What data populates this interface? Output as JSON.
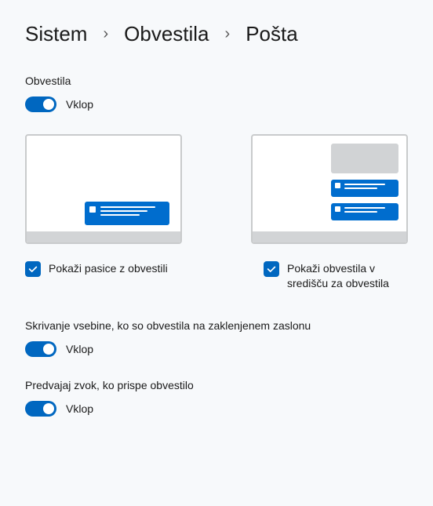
{
  "breadcrumb": {
    "item0": "Sistem",
    "item1": "Obvestila",
    "item2": "Pošta"
  },
  "main": {
    "notifications_label": "Obvestila",
    "notifications_toggle_state": "Vklop",
    "banner_check_label": "Pokaži pasice z obvestili",
    "action_center_check_label": "Pokaži obvestila v središču za obvestila",
    "hide_lock_label": "Skrivanje vsebine, ko so obvestila na zaklenjenem zaslonu",
    "hide_lock_toggle_state": "Vklop",
    "sound_label": "Predvajaj zvok, ko prispe obvestilo",
    "sound_toggle_state": "Vklop"
  },
  "colors": {
    "accent": "#0067c0"
  }
}
